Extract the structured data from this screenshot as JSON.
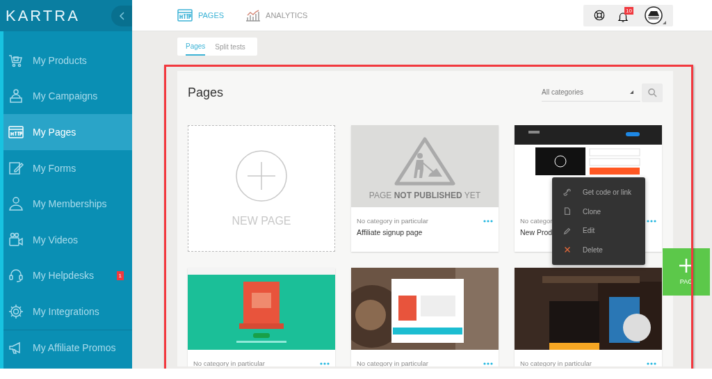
{
  "sidebar": {
    "logo": "KARTRA",
    "items": [
      {
        "label": "My Products",
        "kind": "products",
        "selected": false
      },
      {
        "label": "My Campaigns",
        "kind": "campaigns",
        "selected": false
      },
      {
        "label": "My Pages",
        "kind": "pages",
        "selected": true
      },
      {
        "label": "My Forms",
        "kind": "forms",
        "selected": false
      },
      {
        "label": "My Memberships",
        "kind": "memberships",
        "selected": false
      },
      {
        "label": "My Videos",
        "kind": "videos",
        "selected": false
      },
      {
        "label": "My Helpdesks",
        "kind": "helpdesks",
        "selected": false,
        "badge": "1"
      },
      {
        "label": "My Integrations",
        "kind": "integrations",
        "selected": false
      },
      {
        "label": "My Affiliate Promos",
        "kind": "affiliates",
        "selected": false
      }
    ]
  },
  "topnav": [
    {
      "label": "PAGES",
      "kind": "pages",
      "selected": true
    },
    {
      "label": "ANALYTICS",
      "kind": "analytics",
      "selected": false
    }
  ],
  "notifications": {
    "count": "10"
  },
  "subtabs": [
    {
      "label": "Pages",
      "selected": true
    },
    {
      "label": "Split tests",
      "selected": false
    }
  ],
  "panel": {
    "title": "Pages",
    "category_filter": "All categories",
    "cards": [
      {
        "kind": "new",
        "label": "NEW PAGE"
      },
      {
        "kind": "unpublished",
        "notice": "PAGE **NOT PUBLISHED** YET",
        "category": "No category in particular",
        "name": "Affiliate signup page"
      },
      {
        "kind": "picture",
        "category": "No categor",
        "name": "New Prod"
      },
      {
        "kind": "picture",
        "category": "No category in particular"
      },
      {
        "kind": "picture",
        "category": "No category in particular"
      },
      {
        "kind": "picture",
        "category": "No category in particular"
      }
    ]
  },
  "context_menu": {
    "items": [
      {
        "label": "Get code or link",
        "kind": "link"
      },
      {
        "label": "Clone",
        "kind": "clone"
      },
      {
        "label": "Edit",
        "kind": "edit"
      },
      {
        "label": "Delete",
        "kind": "delete"
      }
    ]
  },
  "add_button": {
    "label": "PAG"
  }
}
